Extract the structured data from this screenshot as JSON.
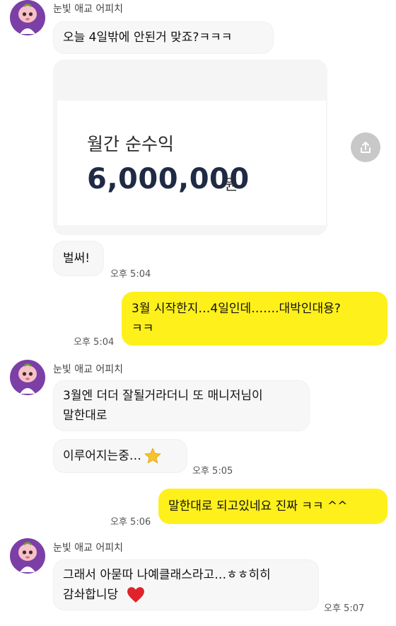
{
  "sender_name": "눈빛 애교 어피치",
  "colors": {
    "accent_yellow": "#fef01b",
    "avatar_bg": "#7b3fa6",
    "heart": "#e0232b",
    "star": "#f7c22b"
  },
  "icons": {
    "avatar": "peach-character-avatar",
    "share": "share-upload-icon",
    "star": "star-emoji",
    "heart": "red-heart-emoji"
  },
  "messages": [
    {
      "id": "m1",
      "text": "오늘 4일밖에 안된거 맞죠?ㅋㅋㅋ"
    },
    {
      "id": "m2_card",
      "title": "월간 순수익",
      "amount": "6,000,000",
      "unit": "원"
    },
    {
      "id": "m3",
      "text": "벌써!",
      "time": "오후 5:04"
    },
    {
      "id": "m4",
      "line1": "3월 시작한지…4일인데…….대박인대용?",
      "line2": "ㅋㅋ",
      "time": "오후 5:04"
    },
    {
      "id": "m5",
      "line1": "3월엔 더더 잘될거라더니 또 매니저님이",
      "line2": "말한대로"
    },
    {
      "id": "m6",
      "text": "이루어지는중…",
      "time": "오후 5:05"
    },
    {
      "id": "m7",
      "text": "말한대로 되고있네요 진짜 ㅋㅋ ^^",
      "time": "오후 5:06"
    },
    {
      "id": "m8",
      "line1": "그래서 아묻따 나예클래스라고…ㅎㅎ히히",
      "line2": "감솨합니당",
      "time": "오후 5:07"
    }
  ]
}
